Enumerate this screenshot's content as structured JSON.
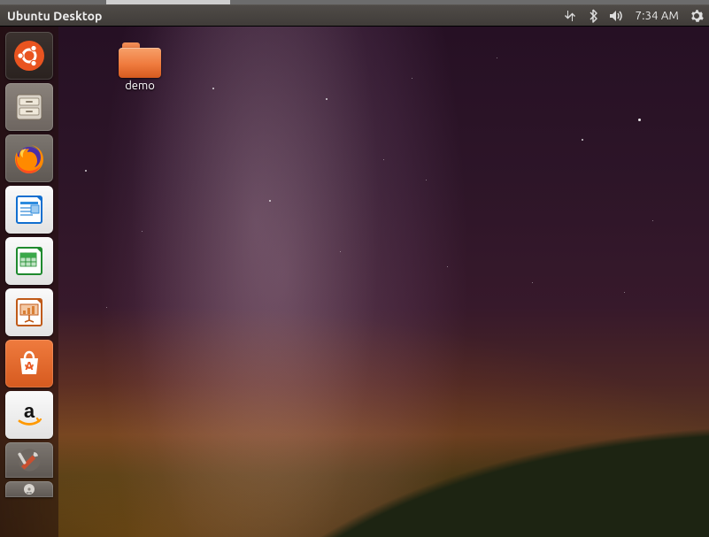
{
  "panel": {
    "title": "Ubuntu Desktop",
    "clock": "7:34 AM"
  },
  "indicators": {
    "network": "network-icon",
    "bluetooth": "bluetooth-icon",
    "volume": "volume-icon",
    "system": "system-gear-icon"
  },
  "desktop": {
    "icons": [
      {
        "name": "demo",
        "type": "folder"
      }
    ]
  },
  "launcher": {
    "items": [
      {
        "id": "dash",
        "label": "Dash"
      },
      {
        "id": "files",
        "label": "Files"
      },
      {
        "id": "firefox",
        "label": "Firefox"
      },
      {
        "id": "writer",
        "label": "LibreOffice Writer"
      },
      {
        "id": "calc",
        "label": "LibreOffice Calc"
      },
      {
        "id": "impress",
        "label": "LibreOffice Impress"
      },
      {
        "id": "software",
        "label": "Ubuntu Software"
      },
      {
        "id": "amazon",
        "label": "Amazon"
      },
      {
        "id": "settings",
        "label": "System Settings"
      },
      {
        "id": "disc",
        "label": "Disc"
      }
    ]
  },
  "colors": {
    "accent": "#e95420",
    "panel": "#3f3b38"
  }
}
